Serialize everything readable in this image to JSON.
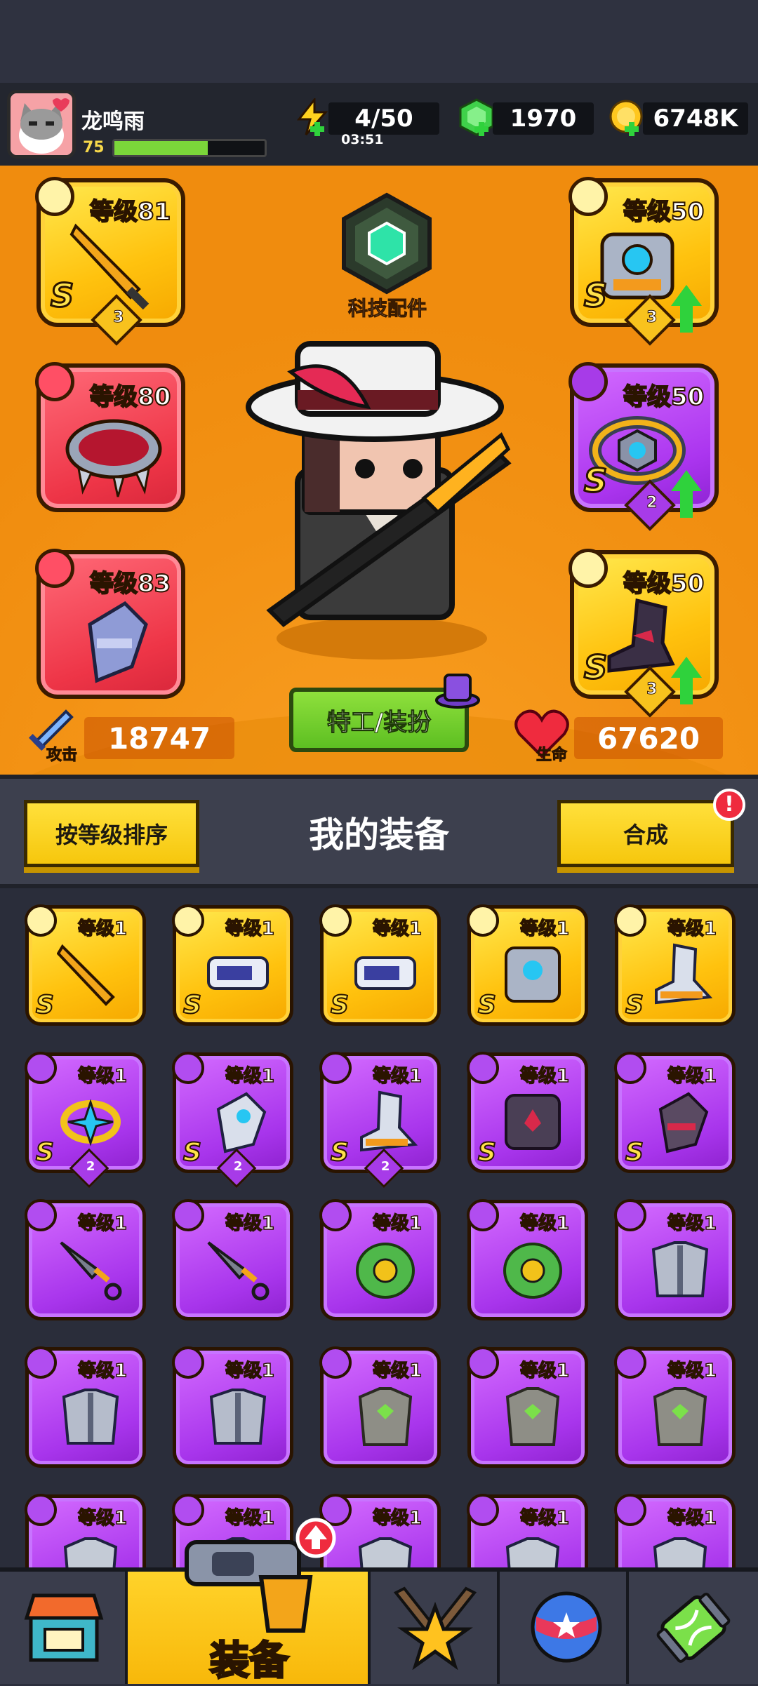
{
  "player": {
    "name": "龙鸣雨",
    "level": "75",
    "xp_fraction": 0.62
  },
  "resources": {
    "energy": "4/50",
    "energy_timer": "03:51",
    "gems": "1970",
    "gold": "6748K"
  },
  "tech": {
    "label": "科技配件"
  },
  "equipped": [
    {
      "slot": "weapon",
      "level": "等级81",
      "rank": "S",
      "stars": "3",
      "color": "gold"
    },
    {
      "slot": "necklace",
      "level": "等级80",
      "rank": "",
      "stars": "",
      "color": "red"
    },
    {
      "slot": "gloves",
      "level": "等级83",
      "rank": "",
      "stars": "",
      "color": "red"
    },
    {
      "slot": "armor",
      "level": "等级50",
      "rank": "S",
      "stars": "3",
      "color": "gold",
      "upgrade": true
    },
    {
      "slot": "belt",
      "level": "等级50",
      "rank": "S",
      "stars": "2",
      "color": "purple",
      "upgrade": true
    },
    {
      "slot": "boots",
      "level": "等级50",
      "rank": "S",
      "stars": "3",
      "color": "gold",
      "upgrade": true
    }
  ],
  "agent_button": "特工/装扮",
  "stats": {
    "attack_label": "攻击",
    "attack": "18747",
    "hp_label": "生命",
    "hp": "67620"
  },
  "equip_bar": {
    "sort_button": "按等级排序",
    "title": "我的装备",
    "merge_button": "合成",
    "merge_alert": "!"
  },
  "inventory": [
    {
      "level": "等级1",
      "color": "gold",
      "rank": "S",
      "stars": "",
      "item": "sword"
    },
    {
      "level": "等级1",
      "color": "gold",
      "rank": "S",
      "stars": "",
      "item": "blaster"
    },
    {
      "level": "等级1",
      "color": "gold",
      "rank": "S",
      "stars": "",
      "item": "blaster"
    },
    {
      "level": "等级1",
      "color": "gold",
      "rank": "S",
      "stars": "",
      "item": "robot-armor"
    },
    {
      "level": "等级1",
      "color": "gold",
      "rank": "S",
      "stars": "",
      "item": "boots"
    },
    {
      "level": "等级1",
      "color": "purple",
      "rank": "S",
      "stars": "2",
      "item": "ring"
    },
    {
      "level": "等级1",
      "color": "purple",
      "rank": "S",
      "stars": "2",
      "item": "gauntlet"
    },
    {
      "level": "等级1",
      "color": "purple",
      "rank": "S",
      "stars": "2",
      "item": "boots"
    },
    {
      "level": "等级1",
      "color": "purple",
      "rank": "S",
      "stars": "",
      "item": "dark-armor"
    },
    {
      "level": "等级1",
      "color": "purple",
      "rank": "S",
      "stars": "",
      "item": "dark-gauntlet"
    },
    {
      "level": "等级1",
      "color": "purple",
      "rank": "",
      "stars": "",
      "item": "kunai"
    },
    {
      "level": "等级1",
      "color": "purple",
      "rank": "",
      "stars": "",
      "item": "kunai"
    },
    {
      "level": "等级1",
      "color": "purple",
      "rank": "",
      "stars": "",
      "item": "leaf-armor"
    },
    {
      "level": "等级1",
      "color": "purple",
      "rank": "",
      "stars": "",
      "item": "leaf-armor"
    },
    {
      "level": "等级1",
      "color": "purple",
      "rank": "",
      "stars": "",
      "item": "steel-armor"
    },
    {
      "level": "等级1",
      "color": "purple",
      "rank": "",
      "stars": "",
      "item": "steel-armor"
    },
    {
      "level": "等级1",
      "color": "purple",
      "rank": "",
      "stars": "",
      "item": "steel-armor"
    },
    {
      "level": "等级1",
      "color": "purple",
      "rank": "",
      "stars": "",
      "item": "stone-armor"
    },
    {
      "level": "等级1",
      "color": "purple",
      "rank": "",
      "stars": "",
      "item": "stone-armor"
    },
    {
      "level": "等级1",
      "color": "purple",
      "rank": "",
      "stars": "",
      "item": "stone-armor"
    },
    {
      "level": "等级1",
      "color": "purple",
      "rank": "",
      "stars": "",
      "item": "armor"
    },
    {
      "level": "等级1",
      "color": "purple",
      "rank": "",
      "stars": "",
      "item": "armor"
    },
    {
      "level": "等级1",
      "color": "purple",
      "rank": "",
      "stars": "",
      "item": "armor"
    },
    {
      "level": "等级1",
      "color": "purple",
      "rank": "",
      "stars": "",
      "item": "armor"
    },
    {
      "level": "等级1",
      "color": "purple",
      "rank": "",
      "stars": "",
      "item": "armor"
    }
  ],
  "nav": {
    "shop_icon": "shop-icon",
    "equip_label": "装备",
    "skills_icon": "star-swords-icon",
    "ball_icon": "star-ball-icon",
    "dna_icon": "dna-capsule-icon"
  },
  "colors": {
    "hero_bg": "#f08c0e",
    "gold_slot": "#ffc20e",
    "purple_slot": "#a835ec",
    "red_slot": "#ee3547",
    "green_button": "#5dbf22",
    "yellow_button": "#f6c70d"
  }
}
